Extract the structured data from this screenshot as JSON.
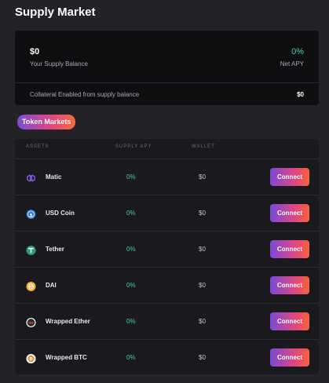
{
  "page": {
    "title": "Supply Market"
  },
  "balance": {
    "supply_balance_value": "$0",
    "supply_balance_label": "Your Supply Balance",
    "net_apy_value": "0%",
    "net_apy_label": "Net APY",
    "collateral_label": "Collateral Enabled from supply balance",
    "collateral_value": "$0"
  },
  "token_markets": {
    "label": "Token Markets"
  },
  "table": {
    "headers": {
      "assets": "ASSETS",
      "supply_apy": "SUPPLY APY",
      "wallet": "WALLET"
    },
    "rows": [
      {
        "name": "Matic",
        "apy": "0%",
        "wallet": "$0",
        "button": "Connect",
        "icon": "matic-icon"
      },
      {
        "name": "USD Coin",
        "apy": "0%",
        "wallet": "$0",
        "button": "Connect",
        "icon": "usd-coin-icon"
      },
      {
        "name": "Tether",
        "apy": "0%",
        "wallet": "$0",
        "button": "Connect",
        "icon": "tether-icon"
      },
      {
        "name": "DAI",
        "apy": "0%",
        "wallet": "$0",
        "button": "Connect",
        "icon": "dai-icon"
      },
      {
        "name": "Wrapped Ether",
        "apy": "0%",
        "wallet": "$0",
        "button": "Connect",
        "icon": "wrapped-ether-icon"
      },
      {
        "name": "Wrapped BTC",
        "apy": "0%",
        "wallet": "$0",
        "button": "Connect",
        "icon": "wrapped-btc-icon"
      }
    ]
  },
  "colors": {
    "background": "#232327",
    "card": "#0e0e11",
    "accent_green": "#3fd3a1",
    "gradient_start": "#7a4ad7",
    "gradient_end": "#f5643a"
  }
}
